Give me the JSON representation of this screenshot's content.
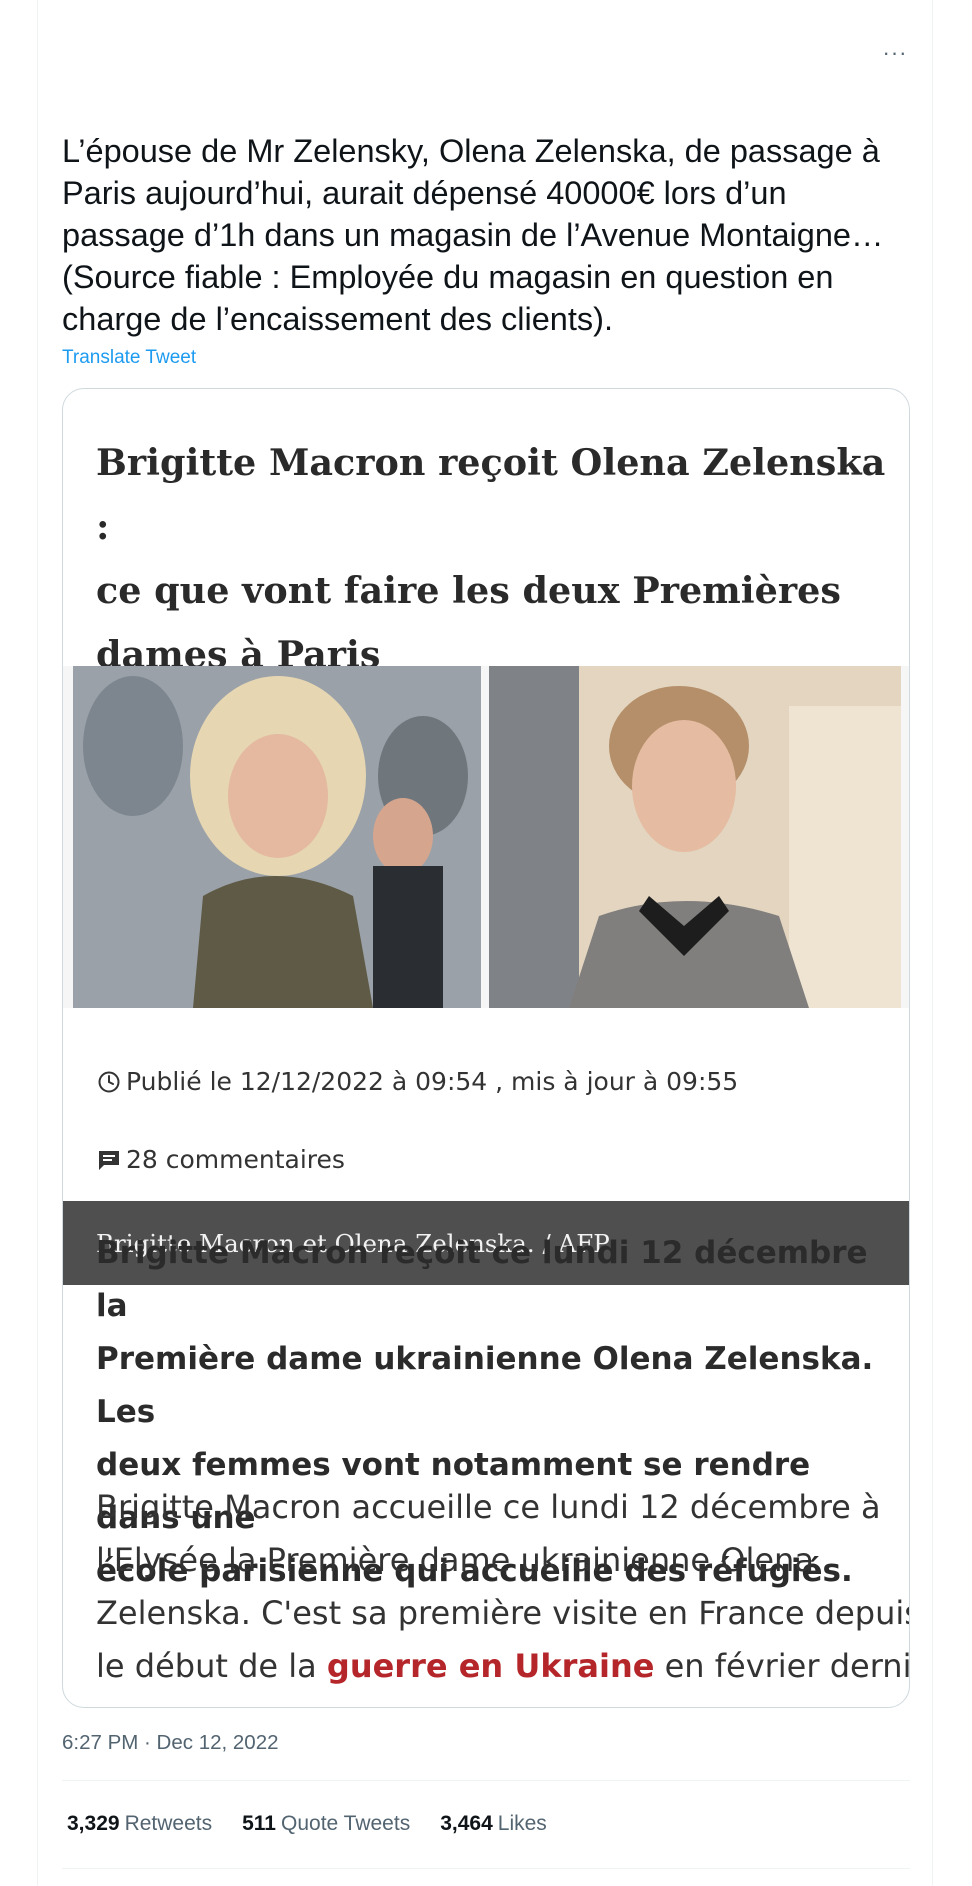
{
  "tweet": {
    "more_label": "···",
    "text": "L’épouse de Mr Zelensky, Olena Zelenska, de passage à\nParis aujourd’hui, aurait dépensé 40000€ lors d’un\npassage d’1h dans un magasin de l’Avenue Montaigne…\n(Source fiable : Employée du magasin en question en\ncharge de l’encaissement des clients).",
    "translate_label": "Translate Tweet",
    "timestamp": "6:27 PM · Dec 12, 2022"
  },
  "card": {
    "headline": "Brigitte Macron reçoit Olena Zelenska :\nce que vont faire les deux Premières\ndames à Paris",
    "photo_caption": "Brigitte Macron et Olena Zelenska.  / AFP",
    "published": "Publié le 12/12/2022 à 09:54 , mis à jour à 09:55",
    "comments": "28 commentaires",
    "lede": "Brigitte Macron reçoit ce lundi 12 décembre la\nPremière dame ukrainienne Olena Zelenska. Les\ndeux femmes vont notamment se rendre dans une\nécole parisienne qui accueille des réfugiés.",
    "body_line1": "Brigitte Macron accueille ce lundi 12 décembre à",
    "body_line2": "l'Elysée la Première dame ukrainienne Olena",
    "body_line3": "Zelenska. C'est sa première visite en France depuis",
    "body_line4_pre": "le début de la ",
    "body_link": "guerre en Ukraine",
    "body_line4_post": " en février dernier.",
    "link_color": "#b5262b"
  },
  "stats": {
    "retweets_count": "3,329",
    "retweets_label": "Retweets",
    "quotes_count": "511",
    "quotes_label": "Quote Tweets",
    "likes_count": "3,464",
    "likes_label": "Likes"
  },
  "icons": {
    "more": "more-icon",
    "clock": "clock-icon",
    "comment": "comment-icon"
  },
  "colors": {
    "accent": "#1d9bf0",
    "secondary_text": "#536471"
  }
}
